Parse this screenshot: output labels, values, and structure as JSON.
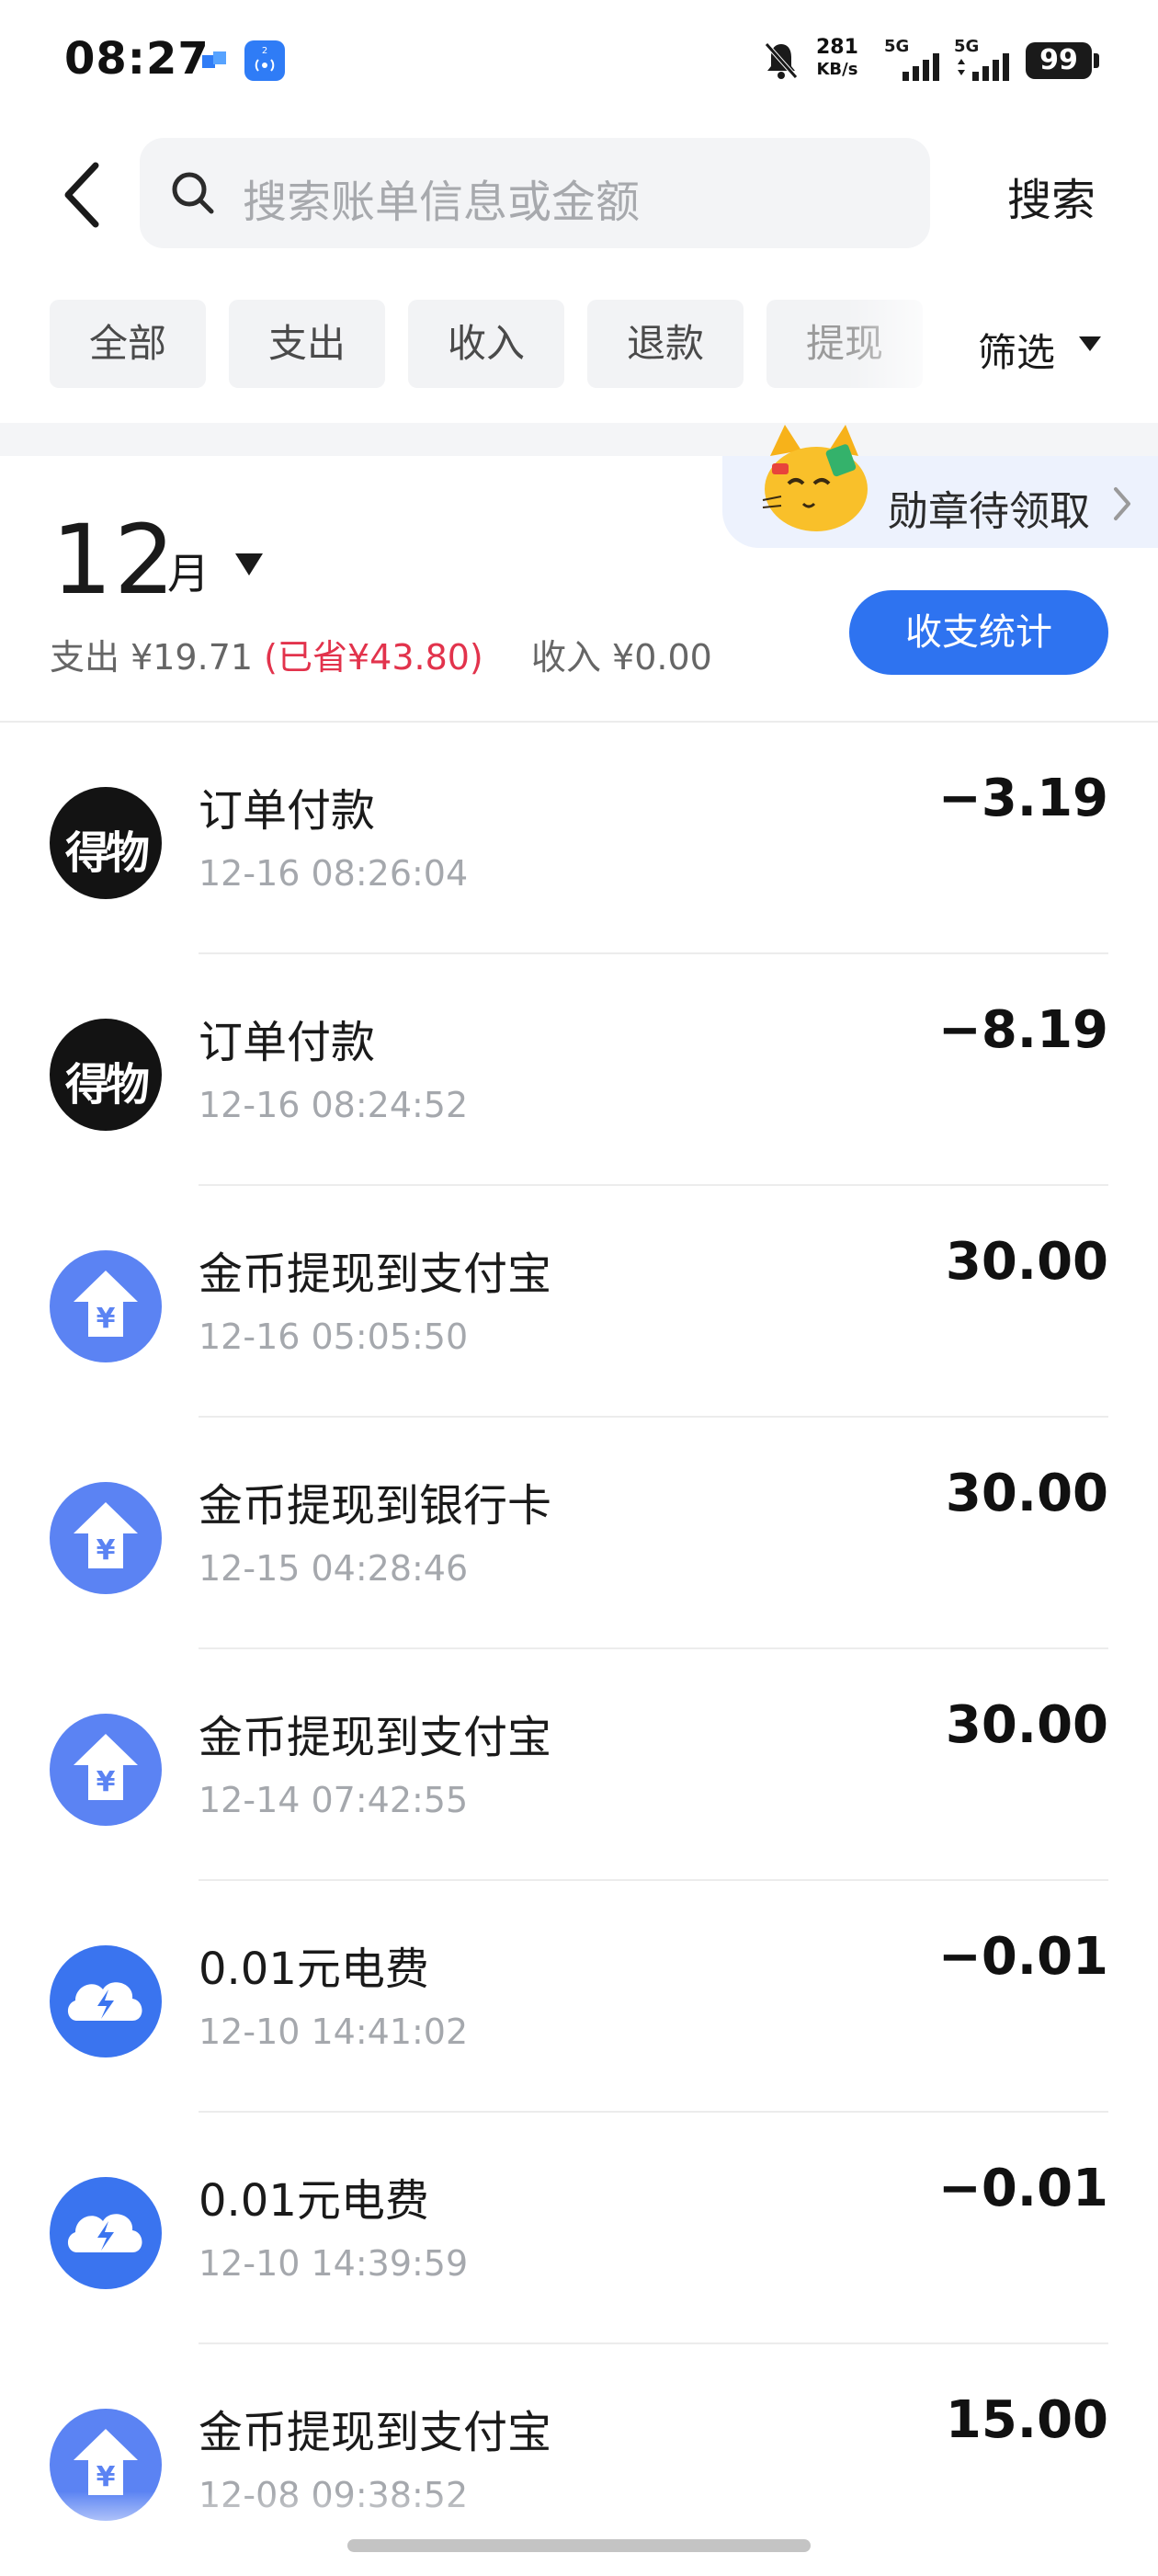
{
  "status": {
    "time": "08:27",
    "nfc_badge": "2",
    "net_speed_value": "281",
    "net_speed_unit": "KB/s",
    "sim1": "5G",
    "sim2": "5G",
    "battery": "99"
  },
  "search": {
    "placeholder": "搜索账单信息或金额",
    "button": "搜索"
  },
  "tabs": [
    {
      "label": "全部"
    },
    {
      "label": "支出"
    },
    {
      "label": "收入"
    },
    {
      "label": "退款"
    },
    {
      "label": "提现"
    }
  ],
  "filter_label": "筛选",
  "badge": {
    "text": "勋章待领取"
  },
  "month": {
    "number": "12",
    "unit": "月",
    "expense": "支出 ¥19.71",
    "saved": "(已省¥43.80)",
    "income": "收入 ¥0.00",
    "stats_button": "收支统计"
  },
  "transactions": [
    {
      "icon": "dewu-logo-icon",
      "avatar_text": "得物",
      "title": "订单付款",
      "time": "12-16 08:26:04",
      "amount": "−3.19"
    },
    {
      "icon": "dewu-logo-icon",
      "avatar_text": "得物",
      "title": "订单付款",
      "time": "12-16 08:24:52",
      "amount": "−8.19"
    },
    {
      "icon": "withdraw-arrow-icon",
      "title": "金币提现到支付宝",
      "time": "12-16 05:05:50",
      "amount": "30.00"
    },
    {
      "icon": "withdraw-arrow-icon",
      "title": "金币提现到银行卡",
      "time": "12-15 04:28:46",
      "amount": "30.00"
    },
    {
      "icon": "withdraw-arrow-icon",
      "title": "金币提现到支付宝",
      "time": "12-14 07:42:55",
      "amount": "30.00"
    },
    {
      "icon": "electricity-cloud-icon",
      "title": "0.01元电费",
      "time": "12-10 14:41:02",
      "amount": "−0.01"
    },
    {
      "icon": "electricity-cloud-icon",
      "title": "0.01元电费",
      "time": "12-10 14:39:59",
      "amount": "−0.01"
    },
    {
      "icon": "withdraw-arrow-icon",
      "title": "金币提现到支付宝",
      "time": "12-08 09:38:52",
      "amount": "15.00"
    }
  ],
  "colors": {
    "accent_blue": "#2e73f0",
    "saved_red": "#e2334c",
    "withdraw_icon_bg": "#5b83f3",
    "electric_icon_bg": "#3a74ef"
  }
}
